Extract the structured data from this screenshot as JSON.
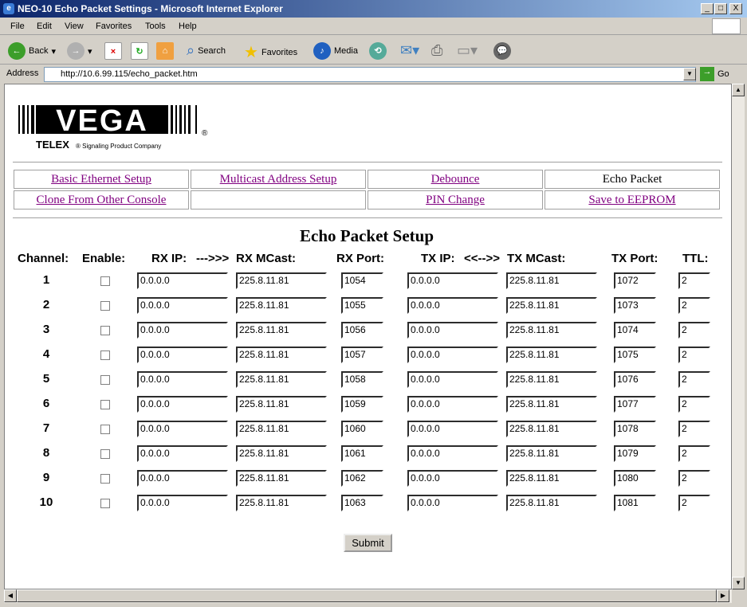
{
  "window": {
    "title": "NEO-10 Echo Packet Settings - Microsoft Internet Explorer",
    "min": "_",
    "max": "□",
    "close": "X"
  },
  "menu": [
    "File",
    "Edit",
    "View",
    "Favorites",
    "Tools",
    "Help"
  ],
  "toolbar": {
    "back": "Back",
    "search": "Search",
    "favorites": "Favorites",
    "media": "Media"
  },
  "address": {
    "label": "Address",
    "url": "http://10.6.99.115/echo_packet.htm",
    "go": "Go"
  },
  "logo": {
    "brand": "VEGA",
    "tagline_brand": "TELEX",
    "tagline": "Signaling Product Company",
    "reg": "®"
  },
  "nav": [
    [
      "Basic Ethernet Setup",
      "Multicast Address Setup",
      "Debounce",
      "Echo Packet"
    ],
    [
      "Clone From Other Console",
      "",
      "PIN Change",
      "Save to EEPROM"
    ]
  ],
  "nav_active": "Echo Packet",
  "page_title": "Echo Packet Setup",
  "headers": {
    "channel": "Channel:",
    "enable": "Enable:",
    "rx_ip": "RX IP:",
    "arrow1": "--->>>",
    "rx_mcast": "RX MCast:",
    "rx_port": "RX Port:",
    "tx_ip": "TX IP:",
    "arrow2": "<<-->>",
    "tx_mcast": "TX MCast:",
    "tx_port": "TX Port:",
    "ttl": "TTL:"
  },
  "rows": [
    {
      "ch": "1",
      "enabled": false,
      "rx_ip": "0.0.0.0",
      "rx_mcast": "225.8.11.81",
      "rx_port": "1054",
      "tx_ip": "0.0.0.0",
      "tx_mcast": "225.8.11.81",
      "tx_port": "1072",
      "ttl": "2"
    },
    {
      "ch": "2",
      "enabled": false,
      "rx_ip": "0.0.0.0",
      "rx_mcast": "225.8.11.81",
      "rx_port": "1055",
      "tx_ip": "0.0.0.0",
      "tx_mcast": "225.8.11.81",
      "tx_port": "1073",
      "ttl": "2"
    },
    {
      "ch": "3",
      "enabled": false,
      "rx_ip": "0.0.0.0",
      "rx_mcast": "225.8.11.81",
      "rx_port": "1056",
      "tx_ip": "0.0.0.0",
      "tx_mcast": "225.8.11.81",
      "tx_port": "1074",
      "ttl": "2"
    },
    {
      "ch": "4",
      "enabled": false,
      "rx_ip": "0.0.0.0",
      "rx_mcast": "225.8.11.81",
      "rx_port": "1057",
      "tx_ip": "0.0.0.0",
      "tx_mcast": "225.8.11.81",
      "tx_port": "1075",
      "ttl": "2"
    },
    {
      "ch": "5",
      "enabled": false,
      "rx_ip": "0.0.0.0",
      "rx_mcast": "225.8.11.81",
      "rx_port": "1058",
      "tx_ip": "0.0.0.0",
      "tx_mcast": "225.8.11.81",
      "tx_port": "1076",
      "ttl": "2"
    },
    {
      "ch": "6",
      "enabled": false,
      "rx_ip": "0.0.0.0",
      "rx_mcast": "225.8.11.81",
      "rx_port": "1059",
      "tx_ip": "0.0.0.0",
      "tx_mcast": "225.8.11.81",
      "tx_port": "1077",
      "ttl": "2"
    },
    {
      "ch": "7",
      "enabled": false,
      "rx_ip": "0.0.0.0",
      "rx_mcast": "225.8.11.81",
      "rx_port": "1060",
      "tx_ip": "0.0.0.0",
      "tx_mcast": "225.8.11.81",
      "tx_port": "1078",
      "ttl": "2"
    },
    {
      "ch": "8",
      "enabled": false,
      "rx_ip": "0.0.0.0",
      "rx_mcast": "225.8.11.81",
      "rx_port": "1061",
      "tx_ip": "0.0.0.0",
      "tx_mcast": "225.8.11.81",
      "tx_port": "1079",
      "ttl": "2"
    },
    {
      "ch": "9",
      "enabled": false,
      "rx_ip": "0.0.0.0",
      "rx_mcast": "225.8.11.81",
      "rx_port": "1062",
      "tx_ip": "0.0.0.0",
      "tx_mcast": "225.8.11.81",
      "tx_port": "1080",
      "ttl": "2"
    },
    {
      "ch": "10",
      "enabled": false,
      "rx_ip": "0.0.0.0",
      "rx_mcast": "225.8.11.81",
      "rx_port": "1063",
      "tx_ip": "0.0.0.0",
      "tx_mcast": "225.8.11.81",
      "tx_port": "1081",
      "ttl": "2"
    }
  ],
  "submit": "Submit"
}
